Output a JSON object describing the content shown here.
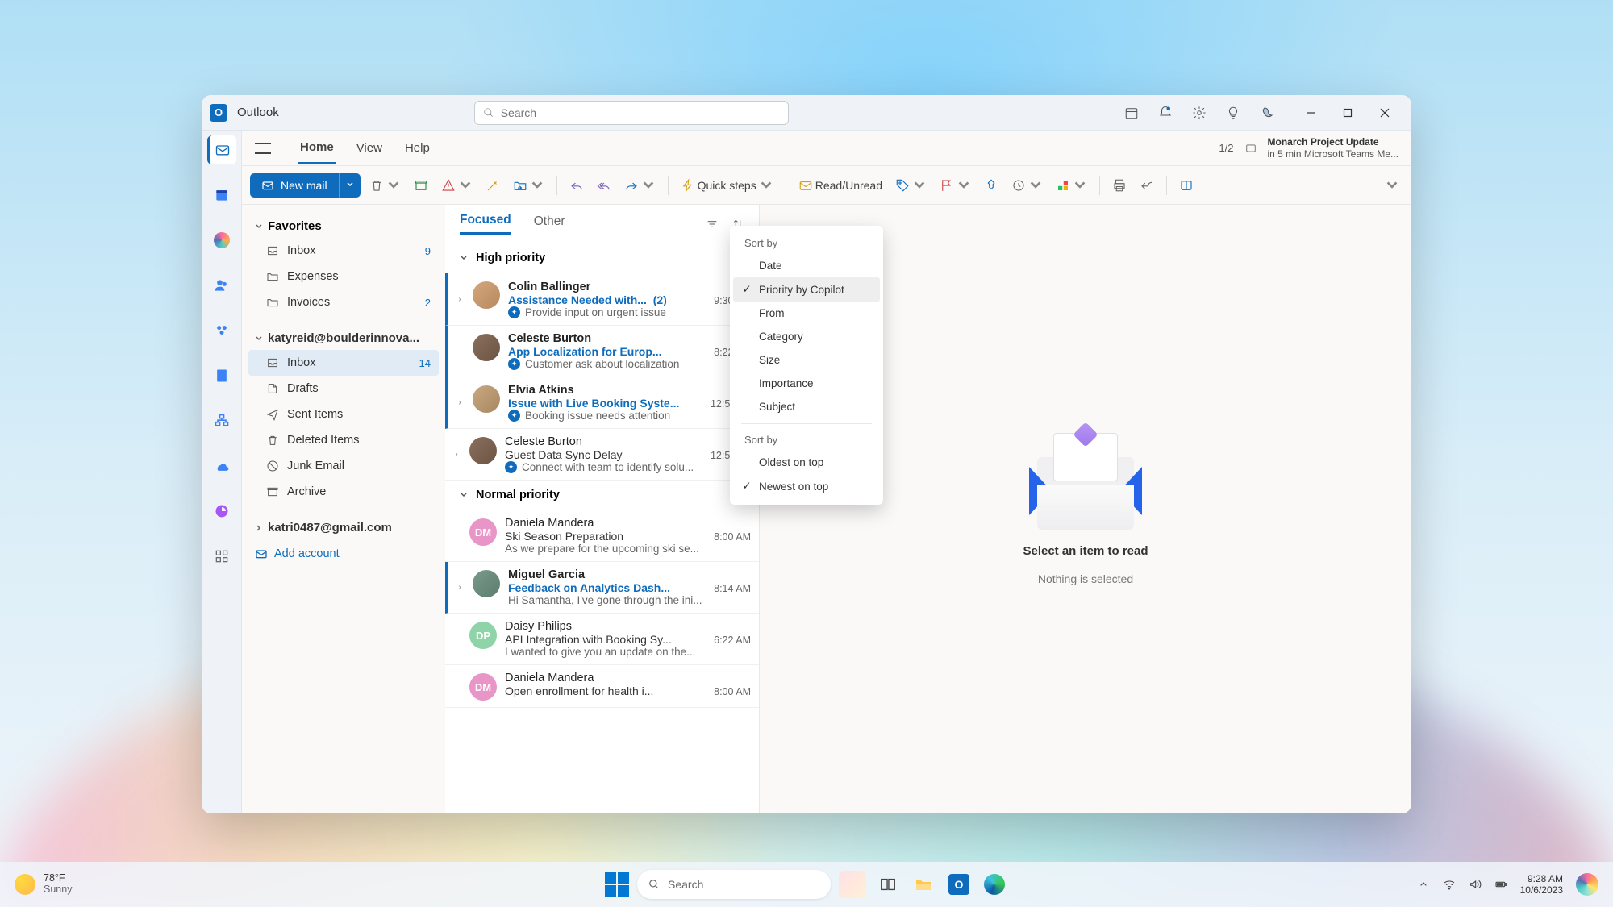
{
  "app": {
    "name": "Outlook"
  },
  "search": {
    "placeholder": "Search"
  },
  "window_tabs": {
    "home": "Home",
    "view": "View",
    "help": "Help",
    "counter": "1/2",
    "reminder_title": "Monarch Project Update",
    "reminder_sub": "in 5 min Microsoft Teams Me..."
  },
  "ribbon": {
    "new_mail": "New mail",
    "quick_steps": "Quick steps",
    "read_unread": "Read/Unread"
  },
  "nav": {
    "favorites": "Favorites",
    "inbox": "Inbox",
    "inbox_count": "9",
    "expenses": "Expenses",
    "invoices": "Invoices",
    "invoices_count": "2",
    "account1": "katyreid@boulderinnova...",
    "inbox2": "Inbox",
    "inbox2_count": "14",
    "drafts": "Drafts",
    "sent": "Sent Items",
    "deleted": "Deleted Items",
    "junk": "Junk Email",
    "archive": "Archive",
    "account2": "katri0487@gmail.com",
    "add": "Add account"
  },
  "msglist": {
    "focused": "Focused",
    "other": "Other",
    "group_high": "High priority",
    "group_normal": "Normal priority",
    "items": [
      {
        "from": "Colin Ballinger",
        "subject": "Assistance Needed with...",
        "thread": "(2)",
        "time": "9:30 AM",
        "preview": "Provide input on urgent issue",
        "unread": true,
        "copilot": true,
        "at": true,
        "expand": true,
        "avatar": "photo1"
      },
      {
        "from": "Celeste Burton",
        "subject": "App Localization for Europ...",
        "time": "8:22 AM",
        "preview": "Customer ask about localization",
        "unread": true,
        "copilot": true,
        "avatar": "photo2"
      },
      {
        "from": "Elvia Atkins",
        "subject": "Issue with Live Booking Syste...",
        "time": "12:55PM",
        "preview": "Booking issue needs attention",
        "unread": true,
        "copilot": true,
        "expand": true,
        "avatar": "photo3"
      },
      {
        "from": "Celeste Burton",
        "subject": "Guest Data Sync Delay",
        "time": "12:55PM",
        "preview": "Connect with team to identify solu...",
        "unread": false,
        "copilot": true,
        "expand": true,
        "avatar": "photo2"
      }
    ],
    "normal_items": [
      {
        "from": "Daniela Mandera",
        "subject": "Ski Season Preparation",
        "time": "8:00 AM",
        "preview": "As we prepare for the upcoming ski se...",
        "initials": "DM",
        "avatar": "pink"
      },
      {
        "from": "Miguel Garcia",
        "subject": "Feedback on Analytics Dash...",
        "time": "8:14 AM",
        "preview": "Hi Samantha, I've gone through the ini...",
        "unread": true,
        "expand": true,
        "avatar": "photo4"
      },
      {
        "from": "Daisy Philips",
        "subject": "API Integration with Booking Sy...",
        "time": "6:22 AM",
        "preview": "I wanted to give you an update on the...",
        "initials": "DP",
        "avatar": "green"
      },
      {
        "from": "Daniela Mandera",
        "subject": "Open enrollment for health i...",
        "time": "8:00 AM",
        "preview": "",
        "initials": "DM",
        "avatar": "pink"
      }
    ]
  },
  "sort_menu": {
    "header1": "Sort by",
    "date": "Date",
    "priority": "Priority by Copilot",
    "from": "From",
    "category": "Category",
    "size": "Size",
    "importance": "Importance",
    "subject": "Subject",
    "header2": "Sort by",
    "oldest": "Oldest on top",
    "newest": "Newest on top"
  },
  "read_pane": {
    "title": "Select an item to read",
    "sub": "Nothing is selected"
  },
  "taskbar": {
    "temp": "78°F",
    "cond": "Sunny",
    "search": "Search",
    "time": "9:28 AM",
    "date": "10/6/2023"
  }
}
